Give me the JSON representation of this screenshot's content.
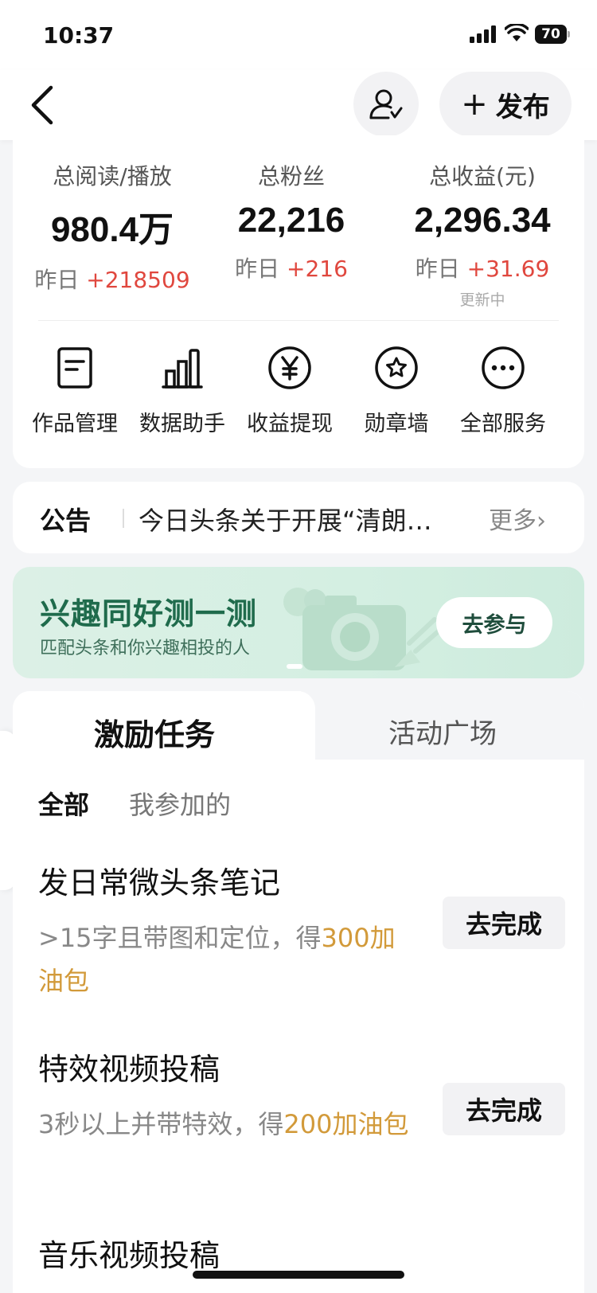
{
  "status_bar": {
    "time": "10:37",
    "battery": "70"
  },
  "header": {
    "publish_label": "发布"
  },
  "stats": [
    {
      "label": "总阅读/播放",
      "value": "980.4万",
      "sub_prefix": "昨日",
      "sub_delta": "+218509"
    },
    {
      "label": "总粉丝",
      "value": "22,216",
      "sub_prefix": "昨日",
      "sub_delta": "+216"
    },
    {
      "label": "总收益(元)",
      "value": "2,296.34",
      "sub_prefix": "昨日",
      "sub_delta": "+31.69",
      "note": "更新中"
    }
  ],
  "services": [
    {
      "label": "作品管理",
      "icon": "document-icon"
    },
    {
      "label": "数据助手",
      "icon": "bar-chart-icon"
    },
    {
      "label": "收益提现",
      "icon": "yen-circle-icon"
    },
    {
      "label": "勋章墙",
      "icon": "medal-icon"
    },
    {
      "label": "全部服务",
      "icon": "more-icon"
    }
  ],
  "notice": {
    "tag": "公告",
    "text": "今日头条关于开展“清朗…",
    "more": "更多›"
  },
  "banner": {
    "title": "兴趣同好测一测",
    "subtitle": "匹配头条和你兴趣相投的人",
    "button": "去参与"
  },
  "tabs": [
    {
      "label": "激励任务",
      "active": true
    },
    {
      "label": "活动广场",
      "active": false
    }
  ],
  "filters": [
    {
      "label": "全部",
      "active": true
    },
    {
      "label": "我参加的",
      "active": false
    }
  ],
  "tasks": [
    {
      "title": "发日常微头条笔记",
      "desc": ">15字且带图和定位，得",
      "reward": "300加油包",
      "button": "去完成"
    },
    {
      "title": "特效视频投稿",
      "desc": "3秒以上并带特效，得",
      "reward": "200加油包",
      "button": "去完成"
    },
    {
      "title": "音乐视频投稿"
    }
  ],
  "colors": {
    "up": "#e0473e",
    "reward": "#d29a3a",
    "banner_title": "#1f6b4c"
  }
}
